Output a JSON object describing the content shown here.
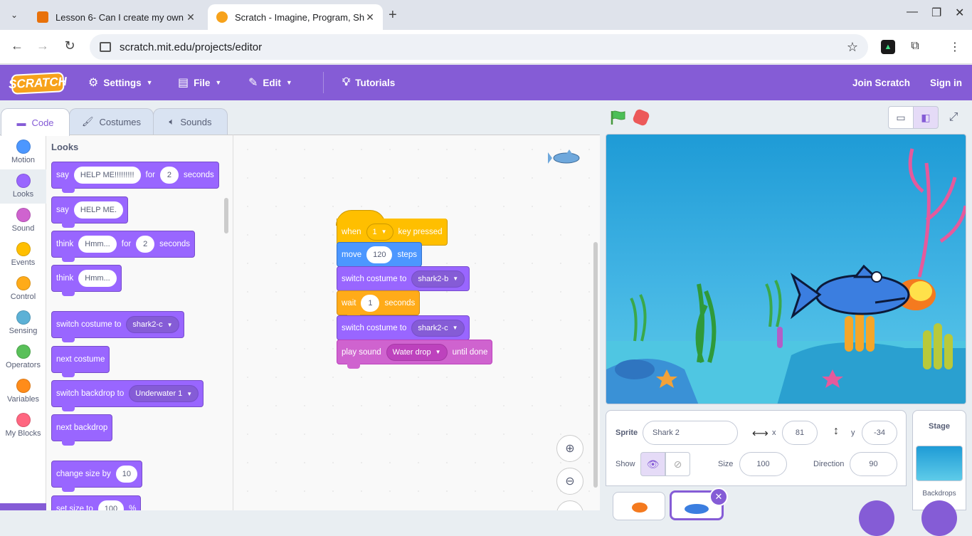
{
  "browser": {
    "tabs": [
      {
        "title": "Lesson 6- Can I create my own",
        "active": false,
        "favicon_color": "#e8710a"
      },
      {
        "title": "Scratch - Imagine, Program, Sha",
        "active": true,
        "favicon_color": "#f7a21b"
      }
    ],
    "url": "scratch.mit.edu/projects/editor"
  },
  "menubar": {
    "logo": "SCRATCH",
    "settings": "Settings",
    "file": "File",
    "edit": "Edit",
    "tutorials": "Tutorials",
    "join": "Join Scratch",
    "signin": "Sign in"
  },
  "editor_tabs": {
    "code": "Code",
    "costumes": "Costumes",
    "sounds": "Sounds"
  },
  "categories": [
    {
      "label": "Motion",
      "color": "#4c97ff"
    },
    {
      "label": "Looks",
      "color": "#9966ff"
    },
    {
      "label": "Sound",
      "color": "#cf63cf"
    },
    {
      "label": "Events",
      "color": "#ffbf00"
    },
    {
      "label": "Control",
      "color": "#ffab19"
    },
    {
      "label": "Sensing",
      "color": "#5cb1d6"
    },
    {
      "label": "Operators",
      "color": "#59c059"
    },
    {
      "label": "Variables",
      "color": "#ff8c1a"
    },
    {
      "label": "My Blocks",
      "color": "#ff6680"
    }
  ],
  "palette": {
    "title": "Looks",
    "say_for": {
      "say": "say",
      "msg": "HELP ME!!!!!!!!!",
      "for": "for",
      "secs": "2",
      "seconds": "seconds"
    },
    "say": {
      "say": "say",
      "msg": "HELP ME."
    },
    "think_for": {
      "think": "think",
      "msg": "Hmm...",
      "for": "for",
      "secs": "2",
      "seconds": "seconds"
    },
    "think": {
      "think": "think",
      "msg": "Hmm..."
    },
    "switch_costume": {
      "label": "switch costume to",
      "value": "shark2-c"
    },
    "next_costume": "next costume",
    "switch_backdrop": {
      "label": "switch backdrop to",
      "value": "Underwater 1"
    },
    "next_backdrop": "next backdrop",
    "change_size": {
      "label": "change size by",
      "value": "10"
    },
    "set_size": {
      "label": "set size to",
      "value": "100",
      "unit": "%"
    }
  },
  "script": {
    "when_key": {
      "when": "when",
      "key": "1",
      "pressed": "key pressed"
    },
    "move": {
      "label": "move",
      "value": "120",
      "steps": "steps"
    },
    "switch1": {
      "label": "switch costume to",
      "value": "shark2-b"
    },
    "wait": {
      "label": "wait",
      "value": "1",
      "seconds": "seconds"
    },
    "switch2": {
      "label": "switch costume to",
      "value": "shark2-c"
    },
    "play_sound": {
      "label": "play sound",
      "value": "Water drop",
      "until": "until done"
    }
  },
  "sprite_info": {
    "sprite_label": "Sprite",
    "sprite_name": "Shark 2",
    "x_label": "x",
    "x": "81",
    "y_label": "y",
    "y": "-34",
    "show_label": "Show",
    "size_label": "Size",
    "size": "100",
    "direction_label": "Direction",
    "direction": "90"
  },
  "stage_panel": {
    "title": "Stage",
    "backdrops": "Backdrops"
  }
}
